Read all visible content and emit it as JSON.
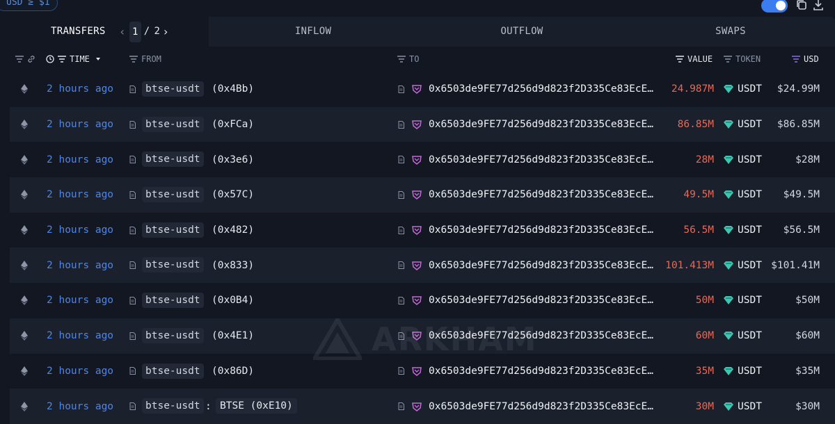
{
  "filter": {
    "label": "USD ≥ $1"
  },
  "tabs": {
    "transfers": "TRANSFERS",
    "inflow": "INFLOW",
    "outflow": "OUTFLOW",
    "swaps": "SWAPS"
  },
  "pager": {
    "current": "1",
    "separator": "/",
    "total": "2"
  },
  "columns": {
    "time": "TIME",
    "from": "FROM",
    "to": "TO",
    "value": "VALUE",
    "token": "TOKEN",
    "usd": "USD"
  },
  "watermark": "ARKHAM",
  "colors": {
    "accent": "#3b7cf0",
    "time_link": "#4f86e6",
    "value_out": "#e46a5a",
    "token_icon": "#3fc6b0",
    "to_entity_icon": "#c36bd6"
  },
  "rows": [
    {
      "time": "2 hours ago",
      "from_label": "btse-usdt",
      "from_addr": "(0x4Bb)",
      "to_addr": "0x6503de9FE77d256d9d823f2D335Ce83EcE…",
      "value": "24.987M",
      "token": "USDT",
      "usd": "$24.99M"
    },
    {
      "time": "2 hours ago",
      "from_label": "btse-usdt",
      "from_addr": "(0xFCa)",
      "to_addr": "0x6503de9FE77d256d9d823f2D335Ce83EcE…",
      "value": "86.85M",
      "token": "USDT",
      "usd": "$86.85M"
    },
    {
      "time": "2 hours ago",
      "from_label": "btse-usdt",
      "from_addr": "(0x3e6)",
      "to_addr": "0x6503de9FE77d256d9d823f2D335Ce83EcE…",
      "value": "28M",
      "token": "USDT",
      "usd": "$28M"
    },
    {
      "time": "2 hours ago",
      "from_label": "btse-usdt",
      "from_addr": "(0x57C)",
      "to_addr": "0x6503de9FE77d256d9d823f2D335Ce83EcE…",
      "value": "49.5M",
      "token": "USDT",
      "usd": "$49.5M"
    },
    {
      "time": "2 hours ago",
      "from_label": "btse-usdt",
      "from_addr": "(0x482)",
      "to_addr": "0x6503de9FE77d256d9d823f2D335Ce83EcE…",
      "value": "56.5M",
      "token": "USDT",
      "usd": "$56.5M"
    },
    {
      "time": "2 hours ago",
      "from_label": "btse-usdt",
      "from_addr": "(0x833)",
      "to_addr": "0x6503de9FE77d256d9d823f2D335Ce83EcE…",
      "value": "101.413M",
      "token": "USDT",
      "usd": "$101.41M"
    },
    {
      "time": "2 hours ago",
      "from_label": "btse-usdt",
      "from_addr": "(0x0B4)",
      "to_addr": "0x6503de9FE77d256d9d823f2D335Ce83EcE…",
      "value": "50M",
      "token": "USDT",
      "usd": "$50M"
    },
    {
      "time": "2 hours ago",
      "from_label": "btse-usdt",
      "from_addr": "(0x4E1)",
      "to_addr": "0x6503de9FE77d256d9d823f2D335Ce83EcE…",
      "value": "60M",
      "token": "USDT",
      "usd": "$60M"
    },
    {
      "time": "2 hours ago",
      "from_label": "btse-usdt",
      "from_addr": "(0x86D)",
      "to_addr": "0x6503de9FE77d256d9d823f2D335Ce83EcE…",
      "value": "35M",
      "token": "USDT",
      "usd": "$35M"
    },
    {
      "time": "2 hours ago",
      "from_label": "btse-usdt",
      "from_sep": ":",
      "from_entity": "BTSE (0xE10)",
      "to_addr": "0x6503de9FE77d256d9d823f2D335Ce83EcE…",
      "value": "30M",
      "token": "USDT",
      "usd": "$30M"
    }
  ]
}
